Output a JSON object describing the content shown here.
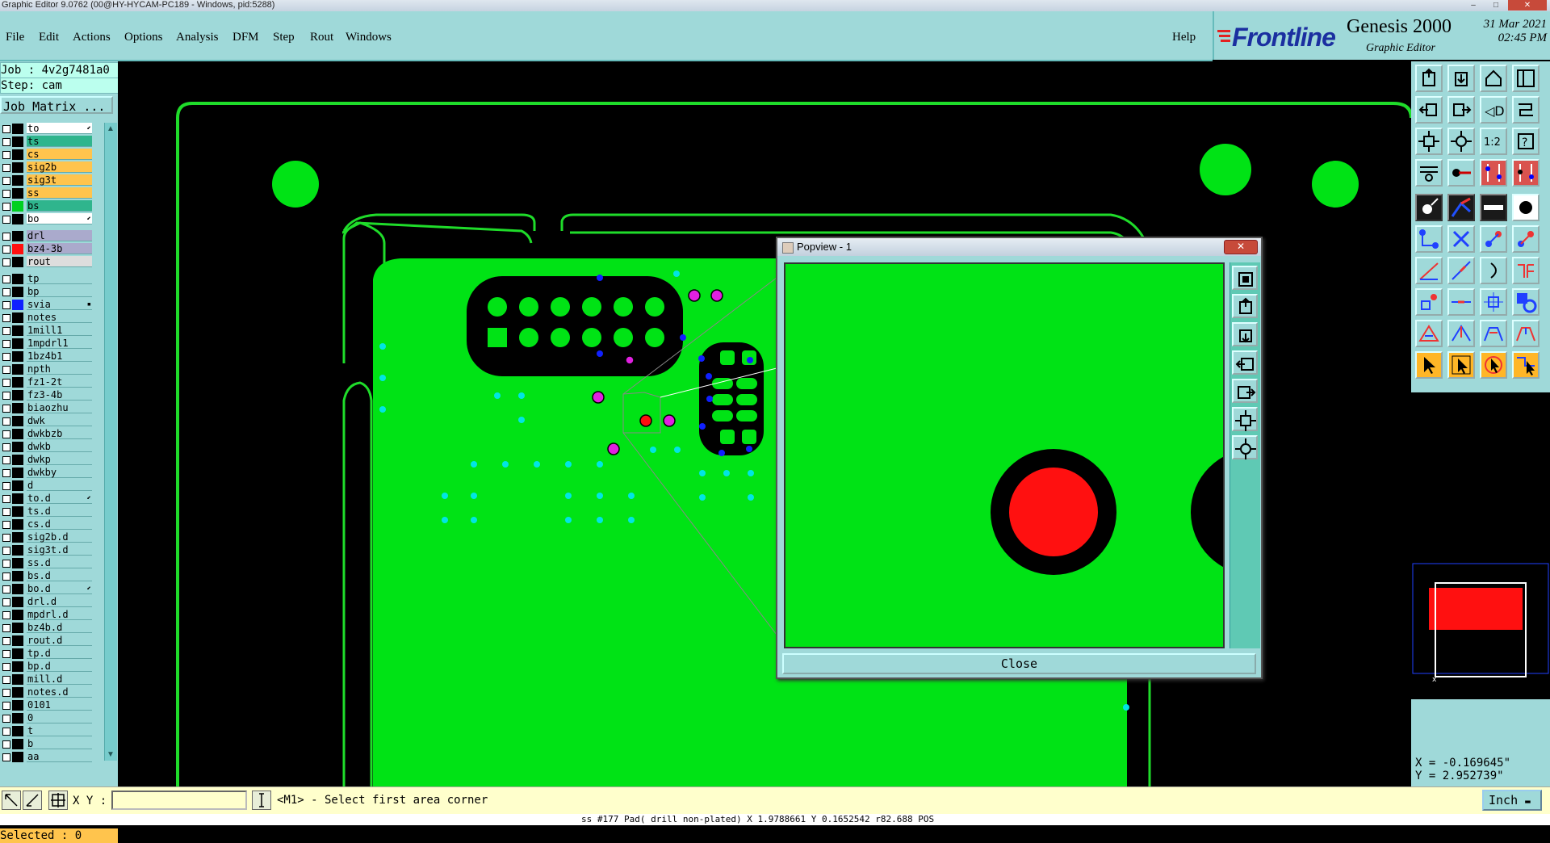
{
  "window": {
    "title": "Graphic Editor 9.0762 (00@HY-HYCAM-PC189 - Windows, pid:5288)",
    "controls": [
      "–",
      "□",
      "✕"
    ]
  },
  "menu": {
    "items": [
      "File",
      "Edit",
      "Actions",
      "Options",
      "Analysis",
      "DFM",
      "Step",
      "Rout",
      "Windows"
    ],
    "help": "Help"
  },
  "brand": {
    "logo": "Frontline",
    "product": "Genesis 2000",
    "subtitle": "Graphic Editor",
    "date": "31 Mar 2021",
    "time": "02:45 PM"
  },
  "left_panel": {
    "job": "Job : 4v2g7481a0",
    "step": "Step: cam",
    "job_matrix": "Job Matrix ...",
    "layers": [
      {
        "name": "to",
        "style": "ww",
        "swatch": "#000",
        "mark": "⬋"
      },
      {
        "name": "ts",
        "style": "teal",
        "swatch": "#000",
        "mark": ""
      },
      {
        "name": "cs",
        "style": "orange",
        "swatch": "#000",
        "mark": ""
      },
      {
        "name": "sig2b",
        "style": "orange",
        "swatch": "#000",
        "mark": ""
      },
      {
        "name": "sig3t",
        "style": "orange",
        "swatch": "#000",
        "mark": ""
      },
      {
        "name": "ss",
        "style": "orange",
        "swatch": "#000",
        "mark": ""
      },
      {
        "name": "bs",
        "style": "teal",
        "swatch": "#00d020",
        "mark": ""
      },
      {
        "name": "bo",
        "style": "ww",
        "swatch": "#000",
        "mark": "⬋"
      },
      {
        "name": "drl",
        "style": "grey",
        "swatch": "#000",
        "mark": ""
      },
      {
        "name": "bz4-3b",
        "style": "grey",
        "swatch": "#ff1010",
        "mark": ""
      },
      {
        "name": "rout",
        "style": "lightgrey",
        "swatch": "#000",
        "mark": ""
      },
      {
        "name": "tp",
        "style": "",
        "swatch": "#000",
        "mark": ""
      },
      {
        "name": "bp",
        "style": "",
        "swatch": "#000",
        "mark": ""
      },
      {
        "name": "svia",
        "style": "",
        "swatch": "#1020ff",
        "mark": "▪"
      },
      {
        "name": "notes",
        "style": "",
        "swatch": "#000",
        "mark": ""
      },
      {
        "name": "1mill1",
        "style": "",
        "swatch": "#000",
        "mark": ""
      },
      {
        "name": "1mpdrl1",
        "style": "",
        "swatch": "#000",
        "mark": ""
      },
      {
        "name": "1bz4b1",
        "style": "",
        "swatch": "#000",
        "mark": ""
      },
      {
        "name": "npth",
        "style": "",
        "swatch": "#000",
        "mark": ""
      },
      {
        "name": "fz1-2t",
        "style": "",
        "swatch": "#000",
        "mark": ""
      },
      {
        "name": "fz3-4b",
        "style": "",
        "swatch": "#000",
        "mark": ""
      },
      {
        "name": "biaozhu",
        "style": "",
        "swatch": "#000",
        "mark": ""
      },
      {
        "name": "dwk",
        "style": "",
        "swatch": "#000",
        "mark": ""
      },
      {
        "name": "dwkbzb",
        "style": "",
        "swatch": "#000",
        "mark": ""
      },
      {
        "name": "dwkb",
        "style": "",
        "swatch": "#000",
        "mark": ""
      },
      {
        "name": "dwkp",
        "style": "",
        "swatch": "#000",
        "mark": ""
      },
      {
        "name": "dwkby",
        "style": "",
        "swatch": "#000",
        "mark": ""
      },
      {
        "name": "d",
        "style": "",
        "swatch": "#000",
        "mark": ""
      },
      {
        "name": "to.d",
        "style": "",
        "swatch": "#000",
        "mark": "⬋"
      },
      {
        "name": "ts.d",
        "style": "",
        "swatch": "#000",
        "mark": ""
      },
      {
        "name": "cs.d",
        "style": "",
        "swatch": "#000",
        "mark": ""
      },
      {
        "name": "sig2b.d",
        "style": "",
        "swatch": "#000",
        "mark": ""
      },
      {
        "name": "sig3t.d",
        "style": "",
        "swatch": "#000",
        "mark": ""
      },
      {
        "name": "ss.d",
        "style": "",
        "swatch": "#000",
        "mark": ""
      },
      {
        "name": "bs.d",
        "style": "",
        "swatch": "#000",
        "mark": ""
      },
      {
        "name": "bo.d",
        "style": "",
        "swatch": "#000",
        "mark": "⬋"
      },
      {
        "name": "drl.d",
        "style": "",
        "swatch": "#000",
        "mark": ""
      },
      {
        "name": "mpdrl.d",
        "style": "",
        "swatch": "#000",
        "mark": ""
      },
      {
        "name": "bz4b.d",
        "style": "",
        "swatch": "#000",
        "mark": ""
      },
      {
        "name": "rout.d",
        "style": "",
        "swatch": "#000",
        "mark": ""
      },
      {
        "name": "tp.d",
        "style": "",
        "swatch": "#000",
        "mark": ""
      },
      {
        "name": "bp.d",
        "style": "",
        "swatch": "#000",
        "mark": ""
      },
      {
        "name": "mill.d",
        "style": "",
        "swatch": "#000",
        "mark": ""
      },
      {
        "name": "notes.d",
        "style": "",
        "swatch": "#000",
        "mark": ""
      },
      {
        "name": "0101",
        "style": "",
        "swatch": "#000",
        "mark": ""
      },
      {
        "name": "0",
        "style": "",
        "swatch": "#000",
        "mark": ""
      },
      {
        "name": "t",
        "style": "",
        "swatch": "#000",
        "mark": ""
      },
      {
        "name": "b",
        "style": "",
        "swatch": "#000",
        "mark": ""
      },
      {
        "name": "aa",
        "style": "",
        "swatch": "#000",
        "mark": ""
      }
    ],
    "selected": "Selected : 0"
  },
  "popview": {
    "title": "Popview - 1",
    "close": "Close"
  },
  "coords": {
    "x": "X = -0.169645\"",
    "y": "Y = 2.952739\""
  },
  "bottom": {
    "xy_label": "X Y :",
    "xy_value": "",
    "prompt": "<M1> - Select first area corner",
    "units": "Inch",
    "status": "ss #177 Pad( drill non-plated) X 1.9788661 Y 0.1652542 r82.688 POS"
  },
  "colors": {
    "panel": "#9fd9d9",
    "board": "#00e315",
    "outline": "#1fdc2a",
    "selection": "#ff1010",
    "via": "#00e5e5",
    "svia": "#1020ff",
    "magenta": "#e020e0"
  }
}
